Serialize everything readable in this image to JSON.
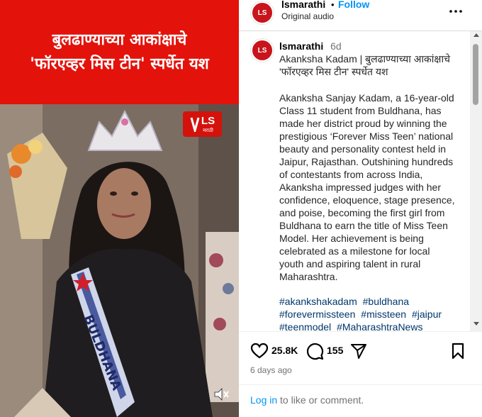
{
  "video": {
    "banner_line1": "बुलढाण्याच्या आकांक्षाचे",
    "banner_line2": "'फॉरएव्हर मिस टीन' स्पर्धेत यश",
    "logo_text": "LS",
    "logo_sub": "मराठी",
    "sash_text": "BULDHANA",
    "mute_icon": "speaker-muted-icon",
    "colors": {
      "banner": "#e3120b",
      "logo": "#d4120c"
    }
  },
  "header": {
    "avatar_text": "LS",
    "username": "lsmarathi",
    "dot": "•",
    "follow_label": "Follow",
    "audio": "Original audio",
    "more_icon": "more-options-icon"
  },
  "caption": {
    "avatar_text": "LS",
    "username": "lsmarathi",
    "time": "6d",
    "title": "Akanksha Kadam | बुलढाण्याच्या आकांक्षाचे 'फॉरएव्हर मिस टीन' स्पर्धेत यश",
    "body": "Akanksha Sanjay Kadam, a 16-year-old Class 11 student from Buldhana, has made her district proud by winning the prestigious ‘Forever Miss Teen’ national beauty and personality contest held in Jaipur, Rajasthan. Outshining hundreds of contestants from across India, Akanksha impressed judges with her confidence, eloquence, stage presence, and poise, becoming the first girl from Buldhana to earn the title of Miss Teen Model. Her achievement is being celebrated as a milestone for local youth and aspiring talent in rural Maharashtra.",
    "hashtags": [
      "#akankshakadam",
      "#buldhana",
      "#forevermissteen",
      "#missteen",
      "#jaipur",
      "#teenmodel",
      "#MaharashtraNews"
    ]
  },
  "actions": {
    "like_icon": "heart-icon",
    "like_count": "25.8K",
    "comment_icon": "comment-bubble-icon",
    "comment_count": "155",
    "share_icon": "paper-plane-icon",
    "save_icon": "bookmark-icon",
    "age": "6 days ago"
  },
  "login": {
    "link": "Log in",
    "rest": " to like or comment."
  },
  "colors": {
    "accent": "#0095f6",
    "hashtag": "#00376b",
    "muted": "#737373"
  }
}
